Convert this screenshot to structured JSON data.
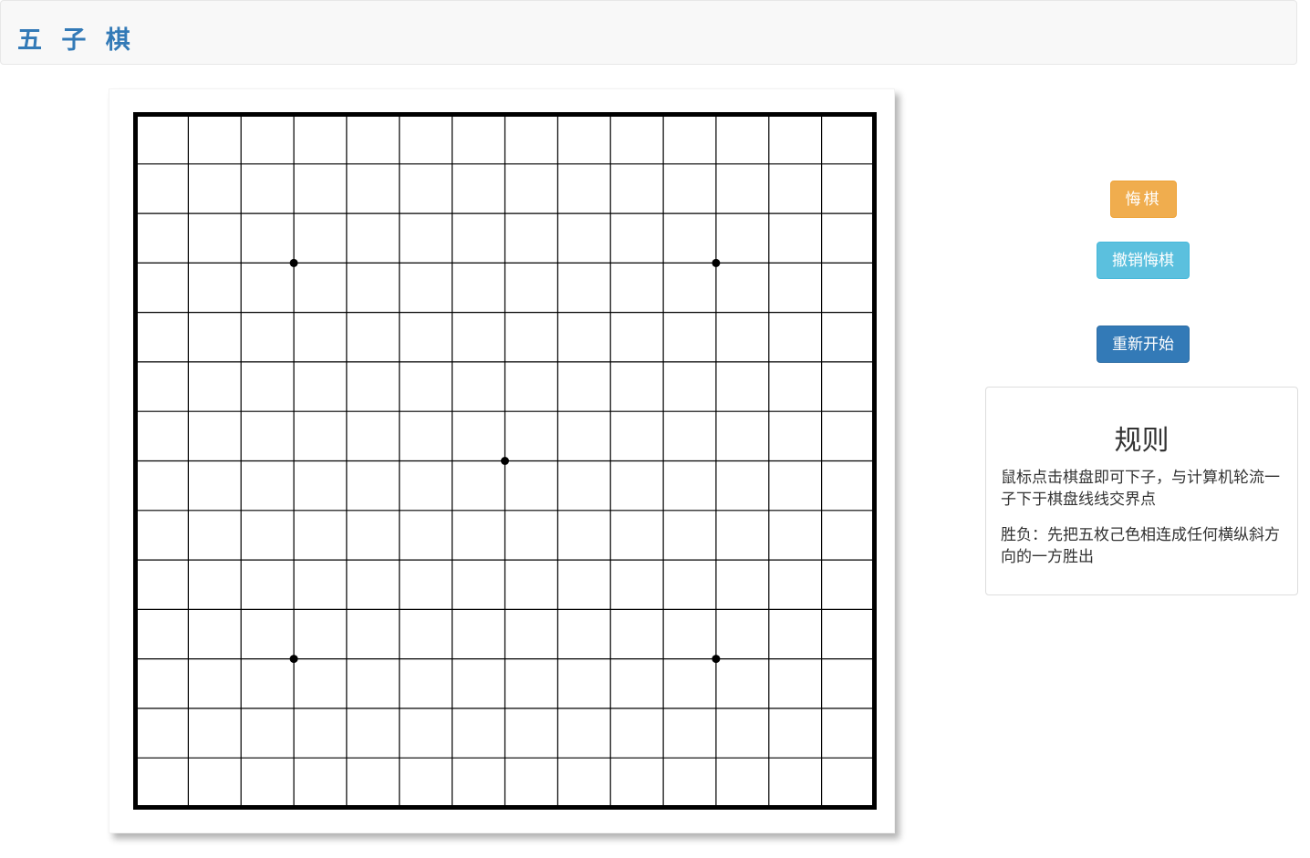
{
  "header": {
    "title": "五 子 棋"
  },
  "board": {
    "columns": 15,
    "rows": 15,
    "star_points": [
      [
        3,
        3
      ],
      [
        11,
        3
      ],
      [
        7,
        7
      ],
      [
        3,
        11
      ],
      [
        11,
        11
      ]
    ],
    "stones": [],
    "line_color": "#000000",
    "background_color": "#ffffff"
  },
  "controls": {
    "undo_label": "悔棋",
    "cancel_undo_label": "撤销悔棋",
    "restart_label": "重新开始",
    "undo_color": "#f0ad4e",
    "cancel_undo_color": "#5bc0de",
    "restart_color": "#337ab7"
  },
  "rules": {
    "title": "规则",
    "paragraphs": [
      "鼠标点击棋盘即可下子，与计算机轮流一子下于棋盘线线交界点",
      "胜负：先把五枚己色相连成任何横纵斜方向的一方胜出"
    ]
  }
}
